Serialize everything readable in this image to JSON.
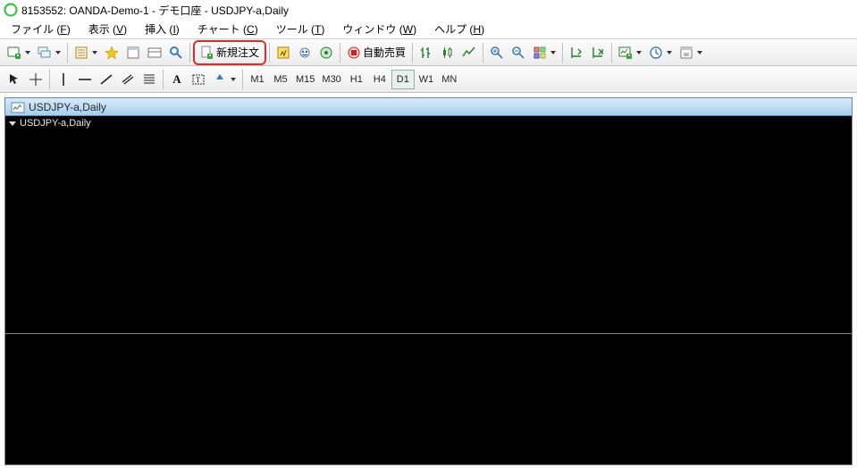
{
  "title": "8153552: OANDA-Demo-1 - デモ口座 - USDJPY-a,Daily",
  "menus": {
    "file": {
      "label": "ファイル",
      "mn": "F"
    },
    "view": {
      "label": "表示",
      "mn": "V"
    },
    "insert": {
      "label": "挿入",
      "mn": "I"
    },
    "chart": {
      "label": "チャート",
      "mn": "C"
    },
    "tools": {
      "label": "ツール",
      "mn": "T"
    },
    "window": {
      "label": "ウィンドウ",
      "mn": "W"
    },
    "help": {
      "label": "ヘルプ",
      "mn": "H"
    }
  },
  "toolbar": {
    "new_order": "新規注文",
    "autotrading": "自動売買"
  },
  "timeframes": {
    "m1": "M1",
    "m5": "M5",
    "m15": "M15",
    "m30": "M30",
    "h1": "H1",
    "h4": "H4",
    "d1": "D1",
    "w1": "W1",
    "mn": "MN"
  },
  "chart": {
    "tab_title": "USDJPY-a,Daily",
    "inner_title": "USDJPY-a,Daily"
  }
}
